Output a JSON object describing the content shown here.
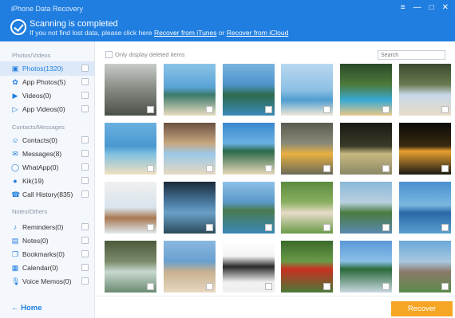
{
  "window": {
    "title": "iPhone Data Recovery",
    "controls": [
      "≡",
      "—",
      "□",
      "✕"
    ]
  },
  "status": {
    "title": "Scanning is completed",
    "sub_prefix": "If you not find lost data, please click here",
    "link_itunes": "Recover from iTunes",
    "or": "or",
    "link_icloud": "Recover from iCloud"
  },
  "sidebar": {
    "groups": [
      {
        "label": "Photos/Videos",
        "items": [
          {
            "label": "Photos(1320)",
            "icon": "photos-icon"
          },
          {
            "label": "App Photos(5)",
            "icon": "app-photos-icon"
          },
          {
            "label": "Videos(0)",
            "icon": "videos-icon"
          },
          {
            "label": "App Videos(0)",
            "icon": "app-videos-icon"
          }
        ]
      },
      {
        "label": "Contacts/Messages",
        "items": [
          {
            "label": "Contacts(0)",
            "icon": "contacts-icon"
          },
          {
            "label": "Messages(8)",
            "icon": "messages-icon"
          },
          {
            "label": "WhatApp(0)",
            "icon": "whatsapp-icon"
          },
          {
            "label": "Kik(19)",
            "icon": "kik-icon"
          },
          {
            "label": "Call History(835)",
            "icon": "call-history-icon"
          }
        ]
      },
      {
        "label": "Notes/Others",
        "items": [
          {
            "label": "Reminders(0)",
            "icon": "reminders-icon"
          },
          {
            "label": "Notes(0)",
            "icon": "notes-icon"
          },
          {
            "label": "Bookmarks(0)",
            "icon": "bookmarks-icon"
          },
          {
            "label": "Calendar(0)",
            "icon": "calendar-icon"
          },
          {
            "label": "Voice Memos(0)",
            "icon": "voice-memos-icon"
          }
        ]
      }
    ],
    "home_label": "Home"
  },
  "toolbar": {
    "only_deleted_label": "Only display deleted items",
    "search_placeholder": "Search"
  },
  "recover_button": "Recover",
  "accent": "#1f7ee0",
  "button_color": "#f5a623"
}
